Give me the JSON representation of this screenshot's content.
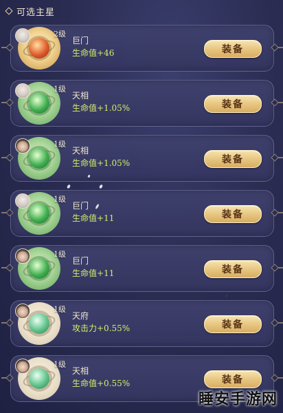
{
  "header": {
    "title": "可选主星"
  },
  "items": [
    {
      "level": "2级",
      "name": "巨门",
      "stat": "生命值+46",
      "button": "装备",
      "orb": "gold",
      "avatar": "light"
    },
    {
      "level": "1级",
      "name": "天相",
      "stat": "生命值+1.05%",
      "button": "装备",
      "orb": "green",
      "avatar": "light"
    },
    {
      "level": "1级",
      "name": "天相",
      "stat": "生命值+1.05%",
      "button": "装备",
      "orb": "green",
      "avatar": "dark"
    },
    {
      "level": "1级",
      "name": "巨门",
      "stat": "生命值+11",
      "button": "装备",
      "orb": "green",
      "avatar": "light"
    },
    {
      "level": "1级",
      "name": "巨门",
      "stat": "生命值+11",
      "button": "装备",
      "orb": "green",
      "avatar": "dark"
    },
    {
      "level": "1级",
      "name": "天府",
      "stat": "攻击力+0.55%",
      "button": "装备",
      "orb": "pale",
      "avatar": "dark"
    },
    {
      "level": "1级",
      "name": "天相",
      "stat": "生命值+0.55%",
      "button": "装备",
      "orb": "pale",
      "avatar": "dark"
    }
  ],
  "watermark": "睡安手游网",
  "colors": {
    "stat": "#d6ee6a",
    "button": "#e6c47e",
    "background": "#2a2c52"
  }
}
